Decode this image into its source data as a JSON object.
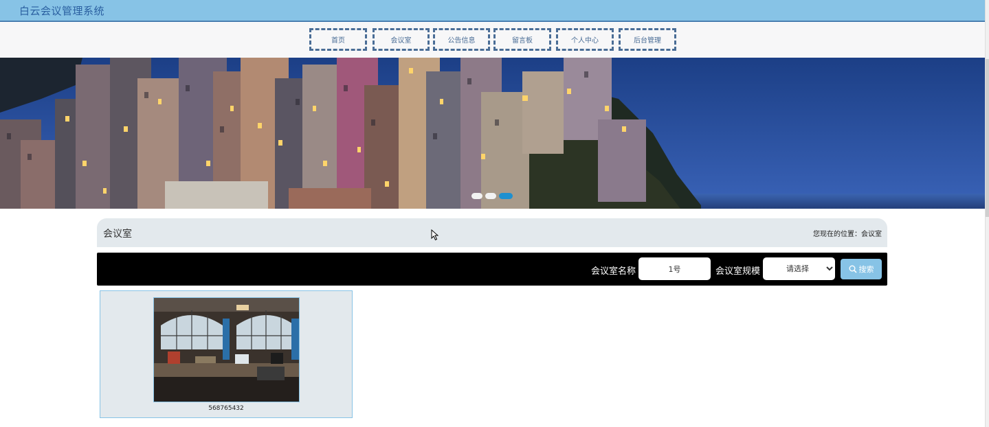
{
  "header": {
    "app_title": "白云会议管理系统",
    "bar_color": "#87c3e6"
  },
  "nav": {
    "items": [
      {
        "label": "首页"
      },
      {
        "label": "会议室"
      },
      {
        "label": "公告信息"
      },
      {
        "label": "留言板"
      },
      {
        "label": "个人中心"
      },
      {
        "label": "后台管理"
      }
    ]
  },
  "banner": {
    "active_slide": 3,
    "slide_count": 3
  },
  "breadcrumb": {
    "title": "会议室",
    "location": "您现在的位置：会议室"
  },
  "search": {
    "name_label": "会议室名称",
    "name_value": "1号",
    "scale_label": "会议室规模",
    "scale_selected": "请选择",
    "button_label": "搜索"
  },
  "rooms": [
    {
      "name": "568765432"
    }
  ],
  "colors": {
    "accent": "#87c3e6",
    "nav_border": "#4a6d96",
    "panel_bg": "#e3e9ed",
    "dot_active": "#1e90d0"
  }
}
